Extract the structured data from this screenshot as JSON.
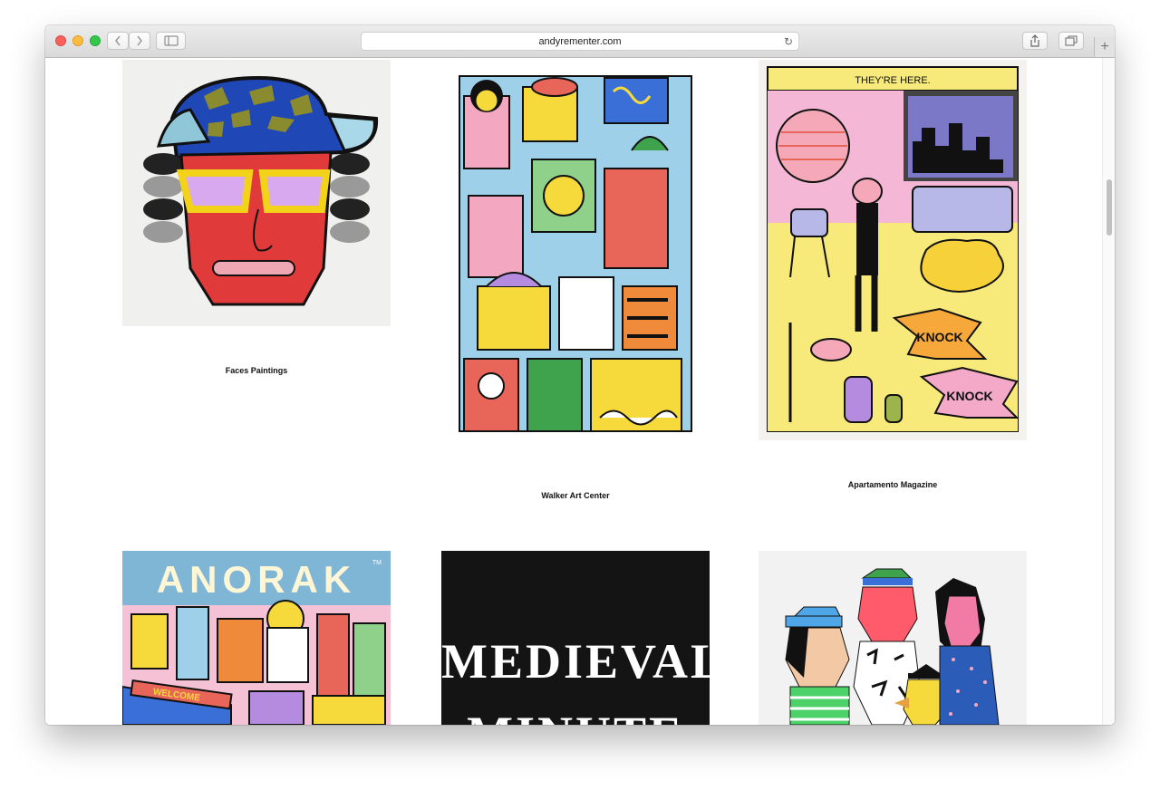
{
  "browser": {
    "url": "andyrementer.com",
    "back_icon": "chevron-left-icon",
    "forward_icon": "chevron-right-icon",
    "sidebar_icon": "sidebar-icon",
    "share_icon": "share-icon",
    "tabs_icon": "tabs-icon",
    "reload_icon": "reload-icon",
    "newtab_icon": "plus-icon"
  },
  "gallery": {
    "items": [
      {
        "caption": "Faces Paintings"
      },
      {
        "caption": "Walker Art Center"
      },
      {
        "caption": "Apartamento Magazine"
      },
      {
        "title_art": "ANORAK",
        "tm": "TM",
        "sign": "WELCOME"
      },
      {
        "line1": "MEDIEVAL",
        "line2": "MINUTE"
      },
      {}
    ],
    "apartamento_art": {
      "banner": "THEY'RE HERE.",
      "knock1": "KNOCK",
      "knock2": "KNOCK"
    }
  },
  "colors": {
    "traffic_red": "#fc605c",
    "traffic_yellow": "#fdbc40",
    "traffic_green": "#34c84a"
  }
}
